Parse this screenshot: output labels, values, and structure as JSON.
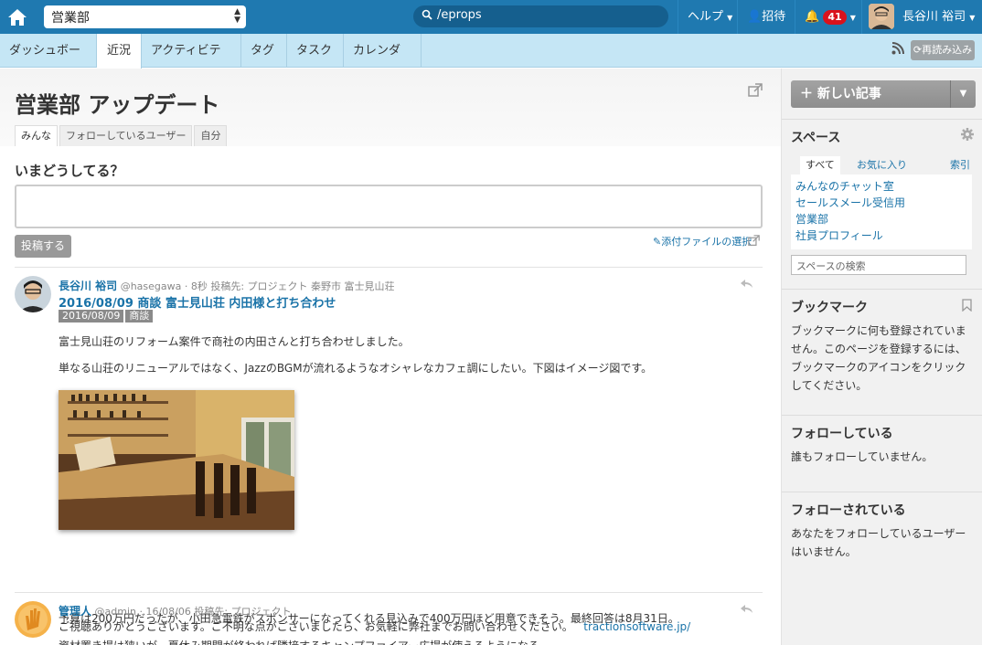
{
  "topbar": {
    "space_name": "営業部",
    "search_value": "/eprops",
    "help_label": "ヘルプ",
    "invite_label": "招待",
    "notification_count": "41",
    "user_name": "長谷川 裕司"
  },
  "subnav": {
    "tabs": [
      {
        "label": "ダッシュボード"
      },
      {
        "label": "近況"
      },
      {
        "label": "アクティビティ"
      },
      {
        "label": "タグ"
      },
      {
        "label": "タスク"
      },
      {
        "label": "カレンダー"
      }
    ],
    "active_tab": "近況",
    "reload_label": "再読み込み"
  },
  "main": {
    "title": "営業部 アップデート",
    "filter_tabs": [
      {
        "label": "みんな"
      },
      {
        "label": "フォローしているユーザー"
      },
      {
        "label": "自分"
      }
    ],
    "status_prompt": "いまどうしてる？",
    "status_value": "",
    "post_button": "投稿する",
    "attach_label": "添付ファイルの選択"
  },
  "entries": [
    {
      "author": "長谷川 裕司",
      "meta": "@hasegawa · 8秒 投稿先: プロジェクト 秦野市 富士見山荘",
      "title": "2016/08/09 商談 富士見山荘 内田様と打ち合わせ",
      "tags": [
        "2016/08/09",
        "商談"
      ],
      "paragraphs": [
        "富士見山荘のリフォーム案件で商社の内田さんと打ち合わせしました。",
        "単なる山荘のリニューアルではなく、JazzのBGMが流れるようなオシャレなカフェ調にしたい。下図はイメージ図です。",
        "予算は200万円だったが、小田急電鉄がスポンサーになってくれる見込みで400万円ほど用意できそう。最終回答は8月31日。",
        "資材置き場は狭いが、夏休み期間が終われば隣接するキャンプファイアー広場が使えるようになる。"
      ]
    },
    {
      "author": "管理人",
      "meta": "@admin · 16/08/06 投稿先: プロジェクト",
      "body": "ご視聴ありがとうございます。ご不明な点がございましたら、お気軽に弊社までお問い合わせください。",
      "link": "tractionsoftware.jp/"
    }
  ],
  "sidebar": {
    "new_post_label": "新しい記事",
    "spaces_title": "スペース",
    "space_tabs": [
      {
        "label": "すべて"
      },
      {
        "label": "お気に入り"
      }
    ],
    "index_label": "索引",
    "spaces": [
      "みんなのチャット室",
      "セールスメール受信用",
      "営業部",
      "社員プロフィール"
    ],
    "space_search_placeholder": "スペースの検索",
    "bookmark_title": "ブックマーク",
    "bookmark_text": "ブックマークに何も登録されていません。このページを登録するには、ブックマークのアイコンをクリックしてください。",
    "following_title": "フォローしている",
    "following_text": "誰もフォローしていません。",
    "followers_title": "フォローされている",
    "followers_text": "あなたをフォローしているユーザーはいません。"
  },
  "colors": {
    "topbar": "#1f79b0",
    "subnav": "#c5e6f5",
    "link": "#1a73a8",
    "badge": "#d9121c"
  }
}
